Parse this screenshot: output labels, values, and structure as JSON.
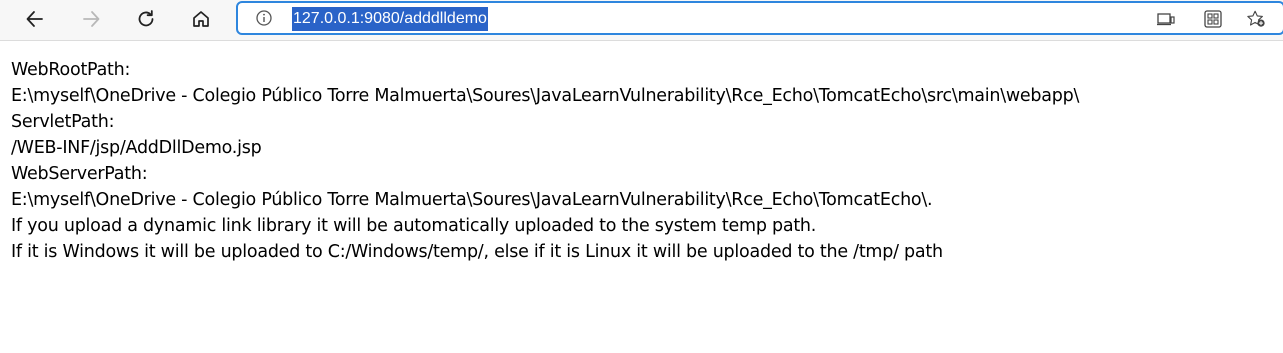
{
  "browser": {
    "url": "127.0.0.1:9080/adddlldemo",
    "icons": {
      "back": "back-arrow-icon",
      "forward": "forward-arrow-icon",
      "refresh": "refresh-icon",
      "home": "home-icon",
      "info": "info-icon",
      "screen_cast": "screen-cast-icon",
      "apps": "apps-icon",
      "favorites": "add-favorite-star-icon"
    },
    "colors": {
      "address_border": "#2e86de",
      "selection": "#2a63c8"
    }
  },
  "page": {
    "lines": [
      "WebRootPath:",
      "E:\\myself\\OneDrive - Colegio Público Torre Malmuerta\\Soures\\JavaLearnVulnerability\\Rce_Echo\\TomcatEcho\\src\\main\\webapp\\",
      "ServletPath:",
      "/WEB-INF/jsp/AddDllDemo.jsp",
      "WebServerPath:",
      "E:\\myself\\OneDrive - Colegio Público Torre Malmuerta\\Soures\\JavaLearnVulnerability\\Rce_Echo\\TomcatEcho\\.",
      "If you upload a dynamic link library it will be automatically uploaded to the system temp path.",
      "If it is Windows it will be uploaded to C:/Windows/temp/, else if it is Linux it will be uploaded to the /tmp/ path"
    ]
  }
}
